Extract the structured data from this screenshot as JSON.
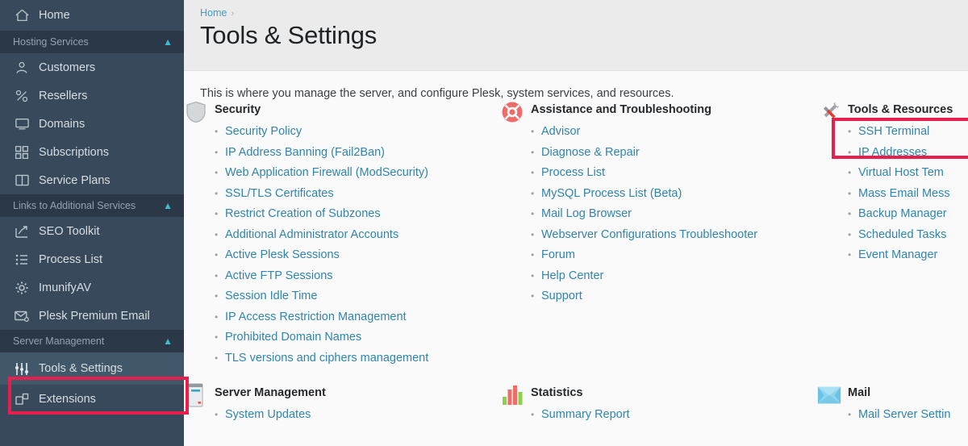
{
  "sidebar": {
    "home": {
      "label": "Home",
      "icon": "home-icon"
    },
    "sections": [
      {
        "label": "Hosting Services",
        "items": [
          {
            "label": "Customers",
            "icon": "user-icon"
          },
          {
            "label": "Resellers",
            "icon": "percent-icon"
          },
          {
            "label": "Domains",
            "icon": "monitor-icon"
          },
          {
            "label": "Subscriptions",
            "icon": "grid-icon"
          },
          {
            "label": "Service Plans",
            "icon": "book-icon"
          }
        ]
      },
      {
        "label": "Links to Additional Services",
        "items": [
          {
            "label": "SEO Toolkit",
            "icon": "chart-arrow-icon"
          },
          {
            "label": "Process List",
            "icon": "list-icon"
          },
          {
            "label": "ImunifyAV",
            "icon": "gear-icon"
          },
          {
            "label": "Plesk Premium Email",
            "icon": "envelope-icon"
          }
        ]
      },
      {
        "label": "Server Management",
        "items": [
          {
            "label": "Tools & Settings",
            "icon": "sliders-icon",
            "active": true
          },
          {
            "label": "Extensions",
            "icon": "puzzle-icon"
          }
        ]
      }
    ],
    "collapse_handle": "‹"
  },
  "header": {
    "breadcrumb_home": "Home",
    "breadcrumb_sep": "›",
    "title": "Tools & Settings"
  },
  "intro": "This is where you manage the server, and configure Plesk, system services, and resources.",
  "groups": [
    {
      "title": "Security",
      "icon": "shield-icon",
      "links": [
        "Security Policy",
        "IP Address Banning (Fail2Ban)",
        "Web Application Firewall (ModSecurity)",
        "SSL/TLS Certificates",
        "Restrict Creation of Subzones",
        "Additional Administrator Accounts",
        "Active Plesk Sessions",
        "Active FTP Sessions",
        "Session Idle Time",
        "IP Access Restriction Management",
        "Prohibited Domain Names",
        "TLS versions and ciphers management"
      ]
    },
    {
      "title": "Assistance and Troubleshooting",
      "icon": "lifebuoy-icon",
      "links": [
        "Advisor",
        "Diagnose & Repair",
        "Process List",
        "MySQL Process List (Beta)",
        "Mail Log Browser",
        "Webserver Configurations Troubleshooter",
        "Forum",
        "Help Center",
        "Support"
      ]
    },
    {
      "title": "Tools & Resources",
      "icon": "tools-icon",
      "links": [
        "SSH Terminal",
        "IP Addresses",
        "Virtual Host Tem",
        "Mass Email Mess",
        "Backup Manager",
        "Scheduled Tasks",
        "Event Manager"
      ]
    },
    {
      "title": "Server Management",
      "icon": "server-icon",
      "links": [
        "System Updates"
      ]
    },
    {
      "title": "Statistics",
      "icon": "bar-chart-icon",
      "links": [
        "Summary Report"
      ]
    },
    {
      "title": "Mail",
      "icon": "mail-icon",
      "links": [
        "Mail Server Settin"
      ]
    }
  ],
  "bullet": "•",
  "colors": {
    "sidebar_bg": "#37495a",
    "sidebar_section_bg": "#2b3847",
    "sidebar_active_bg": "#41586b",
    "link": "#2f85ad",
    "highlight": "#e81e4d",
    "chevron": "#3fbad4"
  }
}
